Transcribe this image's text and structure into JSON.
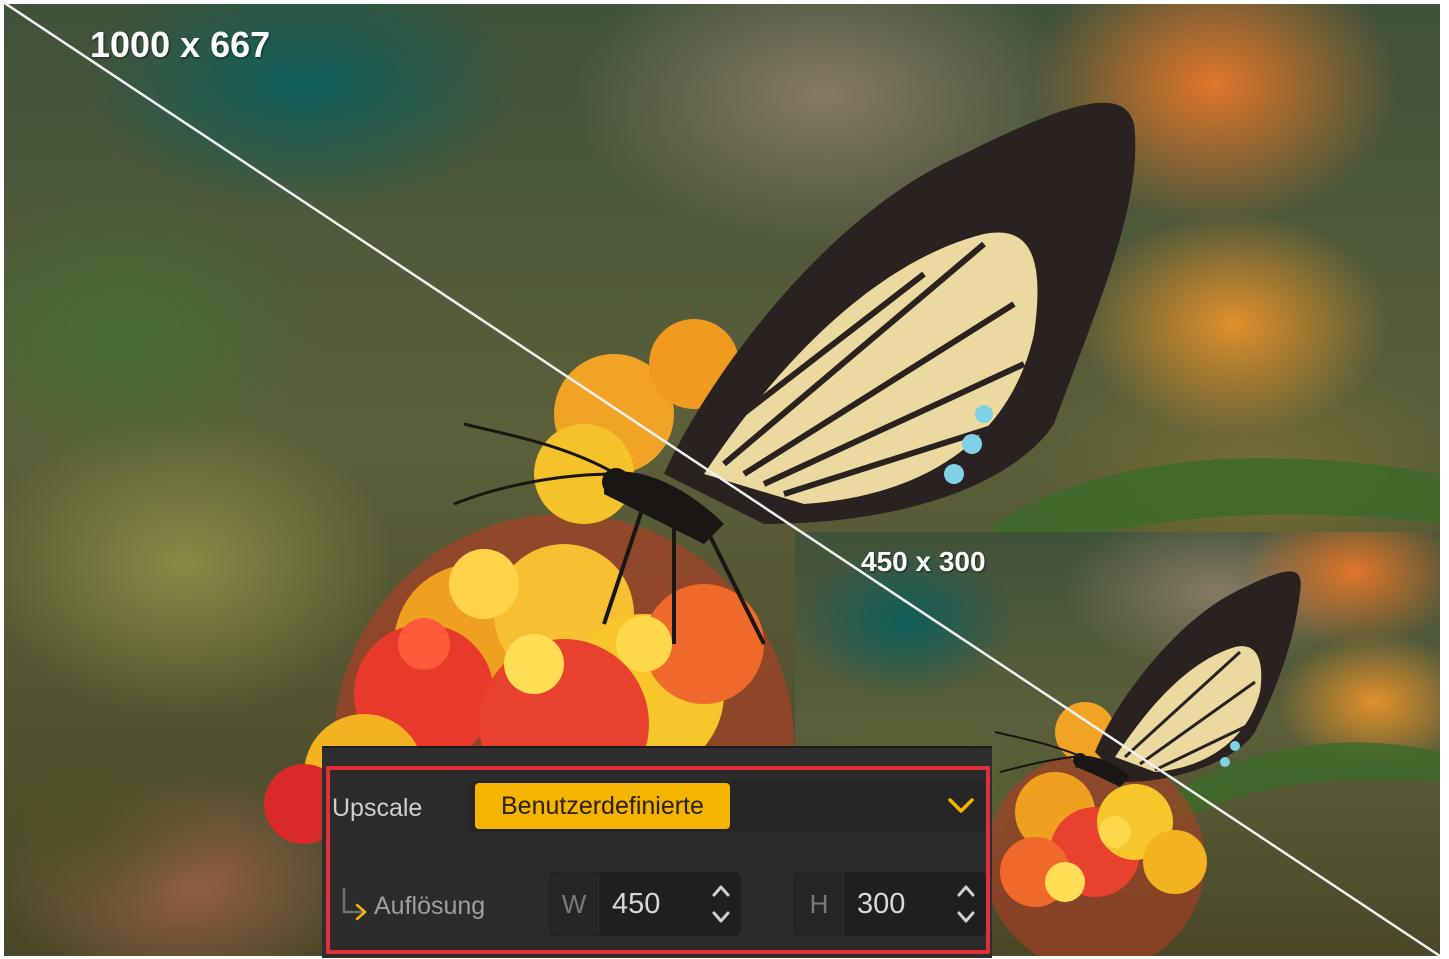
{
  "images": {
    "original_label": "1000 x 667",
    "upscaled_label": "450 x 300"
  },
  "panel": {
    "upscale_label": "Upscale",
    "upscale_value": "Benutzerdefinierte",
    "resolution_label": "Auflösung",
    "width_prefix": "W",
    "width_value": "450",
    "height_prefix": "H",
    "height_value": "300"
  },
  "colors": {
    "accent": "#f4b400",
    "highlight_border": "#e0313b",
    "panel_bg": "#2e2e2e"
  },
  "icons": [
    "chevron-down-icon",
    "sub-item-arrow-icon",
    "stepper-icon"
  ]
}
